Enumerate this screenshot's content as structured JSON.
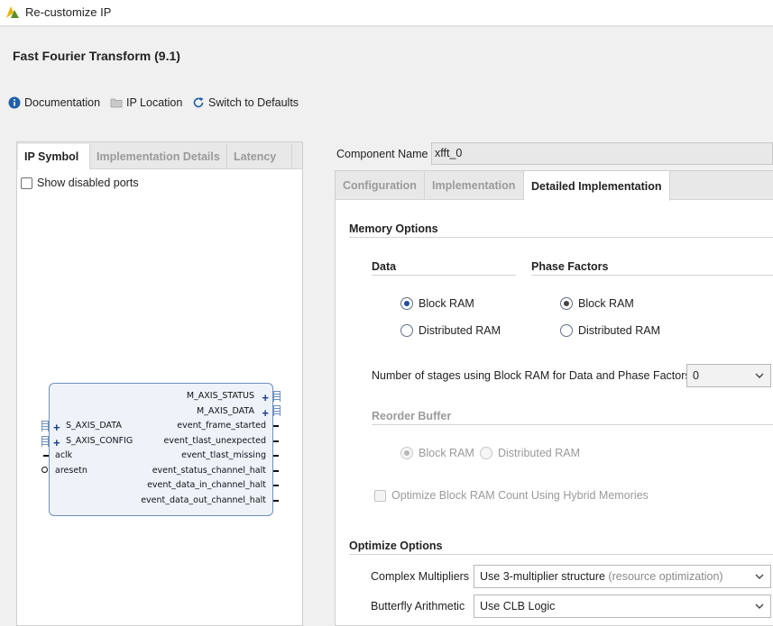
{
  "window": {
    "title": "Re-customize IP"
  },
  "ip": {
    "heading": "Fast Fourier Transform (9.1)"
  },
  "toolbar": {
    "documentation": "Documentation",
    "ip_location": "IP Location",
    "switch_defaults": "Switch to Defaults"
  },
  "left_tabs": [
    "IP Symbol",
    "Implementation Details",
    "Latency"
  ],
  "show_disabled_ports": "Show disabled ports",
  "symbol": {
    "left_ports": [
      "S_AXIS_DATA",
      "S_AXIS_CONFIG",
      "aclk",
      "aresetn"
    ],
    "right_ports": [
      "M_AXIS_STATUS",
      "M_AXIS_DATA",
      "event_frame_started",
      "event_tlast_unexpected",
      "event_tlast_missing",
      "event_status_channel_halt",
      "event_data_in_channel_halt",
      "event_data_out_channel_halt"
    ]
  },
  "component": {
    "label": "Component Name",
    "value": "xfft_0"
  },
  "right_tabs": [
    "Configuration",
    "Implementation",
    "Detailed Implementation"
  ],
  "memory": {
    "title": "Memory Options",
    "data_title": "Data",
    "phase_title": "Phase Factors",
    "data_options": [
      "Block RAM",
      "Distributed RAM"
    ],
    "data_selected": "Block RAM",
    "phase_options": [
      "Block RAM",
      "Distributed RAM"
    ],
    "phase_selected": "Block RAM",
    "stages_label": "Number of stages using Block RAM for Data and Phase Factors",
    "stages_value": "0",
    "reorder_title": "Reorder Buffer",
    "reorder_options": [
      "Block RAM",
      "Distributed RAM"
    ],
    "reorder_selected": "Block RAM",
    "hybrid_label": "Optimize Block RAM Count Using Hybrid Memories"
  },
  "optimize": {
    "title": "Optimize Options",
    "complex_label": "Complex Multipliers",
    "complex_value": "Use 3-multiplier structure",
    "complex_hint": "(resource optimization)",
    "butterfly_label": "Butterfly Arithmetic",
    "butterfly_value": "Use CLB Logic"
  },
  "colors": {
    "accent": "#1f4fa0",
    "symbol_fill": "#eef3fa",
    "symbol_border": "#6f8fbe",
    "disabled_text": "#9a9a9a"
  }
}
